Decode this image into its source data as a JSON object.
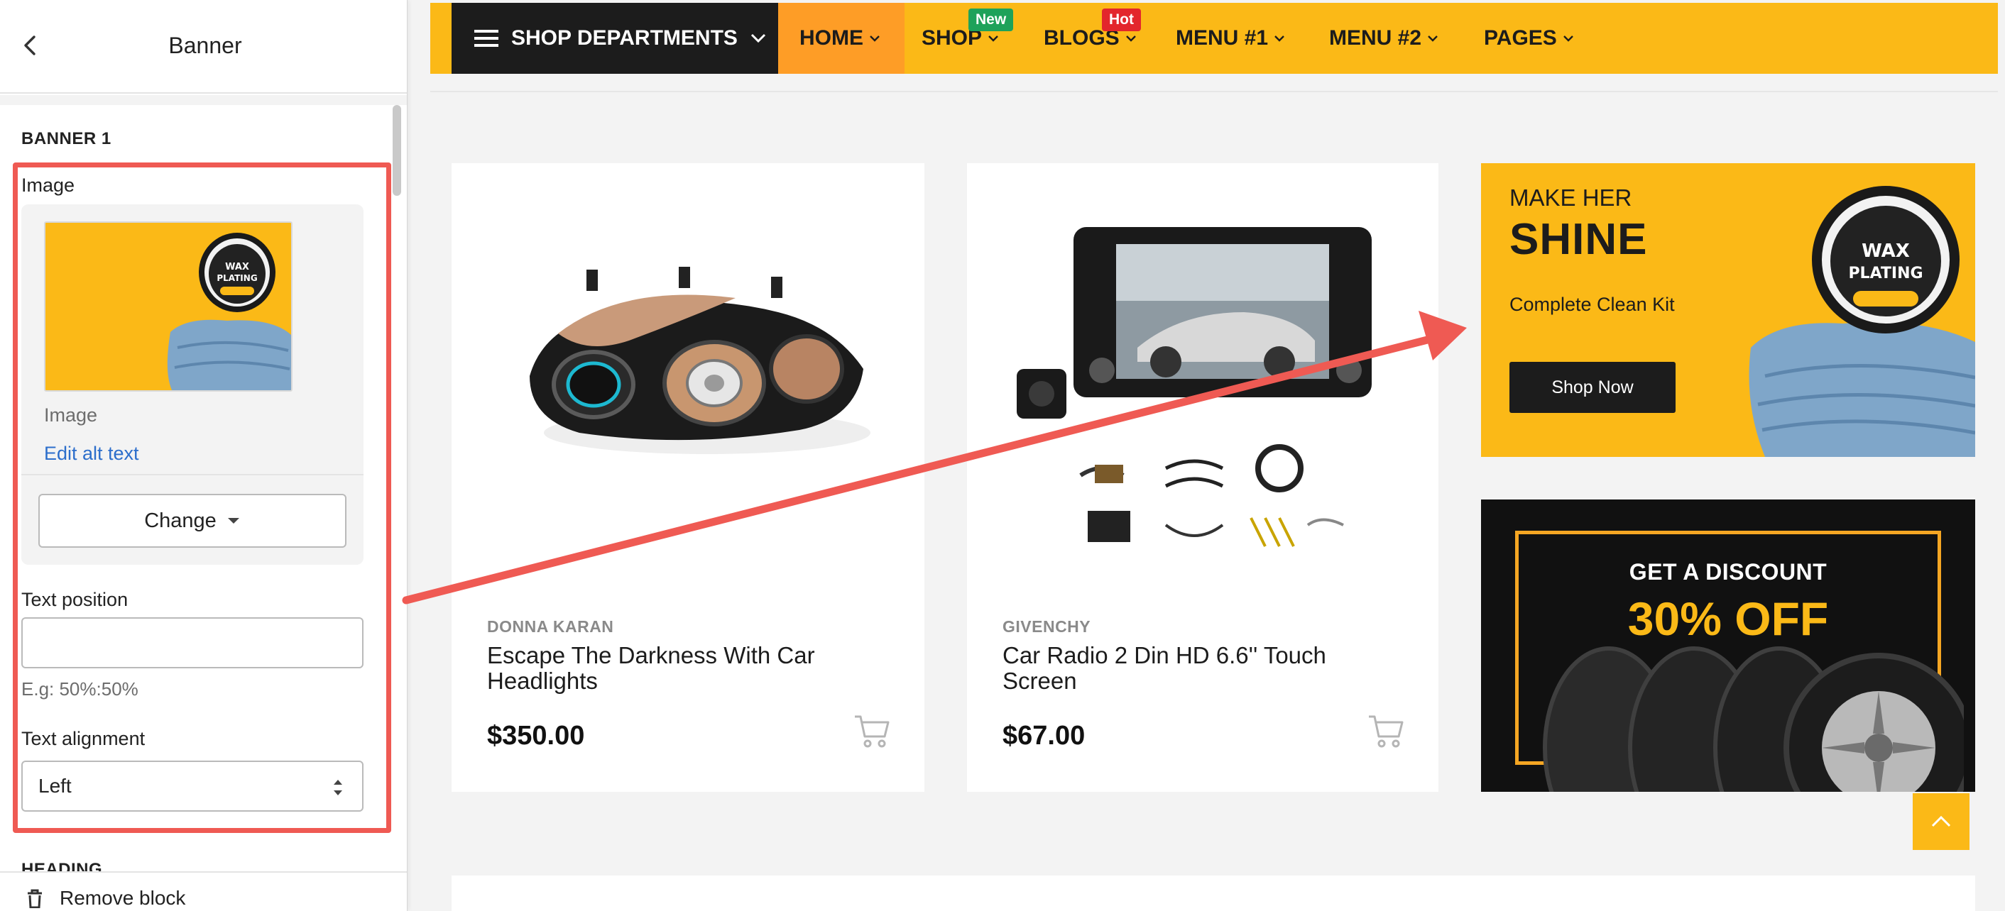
{
  "panel": {
    "title": "Banner",
    "section_title": "BANNER 1",
    "image_label": "Image",
    "image_caption": "Image",
    "edit_alt_text": "Edit alt text",
    "change_label": "Change",
    "text_position_label": "Text position",
    "text_position_value": "",
    "text_position_hint": "E.g: 50%:50%",
    "text_alignment_label": "Text alignment",
    "text_alignment_value": "Left",
    "next_section_title": "HEADING",
    "remove_block_label": "Remove block"
  },
  "thumbnail": {
    "tin_line1": "WAX",
    "tin_line2": "PLATING"
  },
  "nav": {
    "departments": "SHOP DEPARTMENTS",
    "items": [
      {
        "label": "HOME",
        "badge": ""
      },
      {
        "label": "SHOP",
        "badge": "New"
      },
      {
        "label": "BLOGS",
        "badge": "Hot"
      },
      {
        "label": "MENU #1",
        "badge": ""
      },
      {
        "label": "MENU #2",
        "badge": ""
      },
      {
        "label": "PAGES",
        "badge": ""
      }
    ]
  },
  "products": [
    {
      "brand": "DONNA KARAN",
      "title": "Escape The Darkness With Car Headlights",
      "price": "$350.00"
    },
    {
      "brand": "GIVENCHY",
      "title": "Car Radio 2 Din HD 6.6'' Touch Screen",
      "price": "$67.00"
    }
  ],
  "promo_wax": {
    "eyebrow": "MAKE HER",
    "headline": "SHINE",
    "subtitle": "Complete Clean Kit",
    "button": "Shop Now",
    "tin_line1": "WAX",
    "tin_line2": "PLATING"
  },
  "promo_tires": {
    "kicker": "GET A DISCOUNT",
    "offer": "30% OFF"
  },
  "colors": {
    "accent_yellow": "#fbb917",
    "accent_orange": "#fe9d26",
    "annotation_red": "#ef5a53",
    "link_blue": "#2c6ecb",
    "badge_new": "#1ea25a",
    "badge_hot": "#e3262c"
  }
}
